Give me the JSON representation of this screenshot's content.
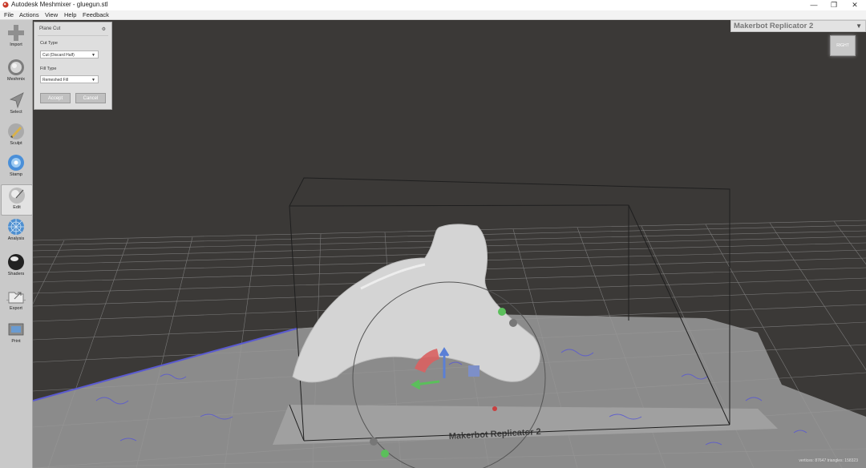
{
  "window": {
    "title": "Autodesk Meshmixer - gluegun.stl",
    "controls": {
      "minimize": "—",
      "maximize": "❐",
      "close": "✕"
    }
  },
  "menu": [
    "File",
    "Actions",
    "View",
    "Help",
    "Feedback"
  ],
  "tools": [
    {
      "label": "Import",
      "icon": "plus-icon"
    },
    {
      "label": "Meshmix",
      "icon": "meshmix-icon"
    },
    {
      "label": "Select",
      "icon": "arrow-cursor-icon"
    },
    {
      "label": "Sculpt",
      "icon": "brush-icon"
    },
    {
      "label": "Stamp",
      "icon": "stamp-icon"
    },
    {
      "label": "Edit",
      "icon": "edit-sphere-icon",
      "active": true
    },
    {
      "label": "Analysis",
      "icon": "analysis-sphere-icon"
    },
    {
      "label": "Shaders",
      "icon": "shader-sphere-icon"
    },
    {
      "label": "Export",
      "icon": "folder-export-icon"
    },
    {
      "label": "Print",
      "icon": "printer-icon"
    }
  ],
  "plane_cut": {
    "title": "Plane Cut",
    "cut_type_label": "Cut Type",
    "cut_type_value": "Cut (Discard Half)",
    "fill_type_label": "Fill Type",
    "fill_type_value": "Remeshed Fill",
    "accept_label": "Accept",
    "cancel_label": "Cancel"
  },
  "printer": {
    "selected": "Makerbot Replicator 2",
    "bed_label": "Makerbot Replicator 2"
  },
  "viewcube": {
    "face_label": "RIGHT"
  },
  "status": {
    "stats": "vertices: 87647  triangles: 158323"
  },
  "colors": {
    "viewport_bg": "#3b3937",
    "grid": "#9a9a9a",
    "mesh": "#d2d2d2",
    "wireframe": "#5a5ad0",
    "gizmo_red": "#d96060",
    "gizmo_green": "#5bbf5b",
    "gizmo_blue": "#5a7fd6"
  }
}
